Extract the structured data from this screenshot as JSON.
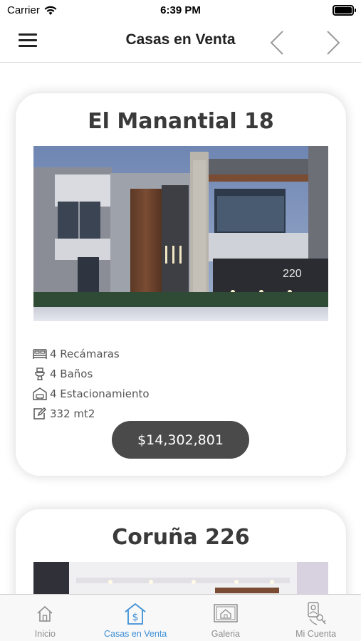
{
  "status_bar": {
    "carrier": "Carrier",
    "time": "6:39 PM"
  },
  "nav": {
    "title": "Casas en Venta",
    "menu_icon": "hamburger-menu-icon",
    "prev_icon": "chevron-left-icon",
    "next_icon": "chevron-right-icon"
  },
  "listings": [
    {
      "title": "El Manantial 18",
      "image_number": "220",
      "features": [
        {
          "icon": "bed-icon",
          "text": "4 Recámaras"
        },
        {
          "icon": "toilet-icon",
          "text": "4 Baños"
        },
        {
          "icon": "garage-icon",
          "text": "4 Estacionamiento"
        },
        {
          "icon": "edit-icon",
          "text": "332 mt2"
        }
      ],
      "price": "$14,302,801"
    },
    {
      "title": "Coruña 226"
    }
  ],
  "tabs": [
    {
      "label": "Inicio",
      "icon": "home-icon",
      "active": false
    },
    {
      "label": "Casas en Venta",
      "icon": "house-dollar-icon",
      "active": true
    },
    {
      "label": "Galeria",
      "icon": "gallery-icon",
      "active": false
    },
    {
      "label": "Mi Cuenta",
      "icon": "account-key-icon",
      "active": false
    }
  ],
  "colors": {
    "accent": "#3d8fd6",
    "price_button": "#4a4a4a",
    "inactive_tab": "#8e8e8e"
  }
}
